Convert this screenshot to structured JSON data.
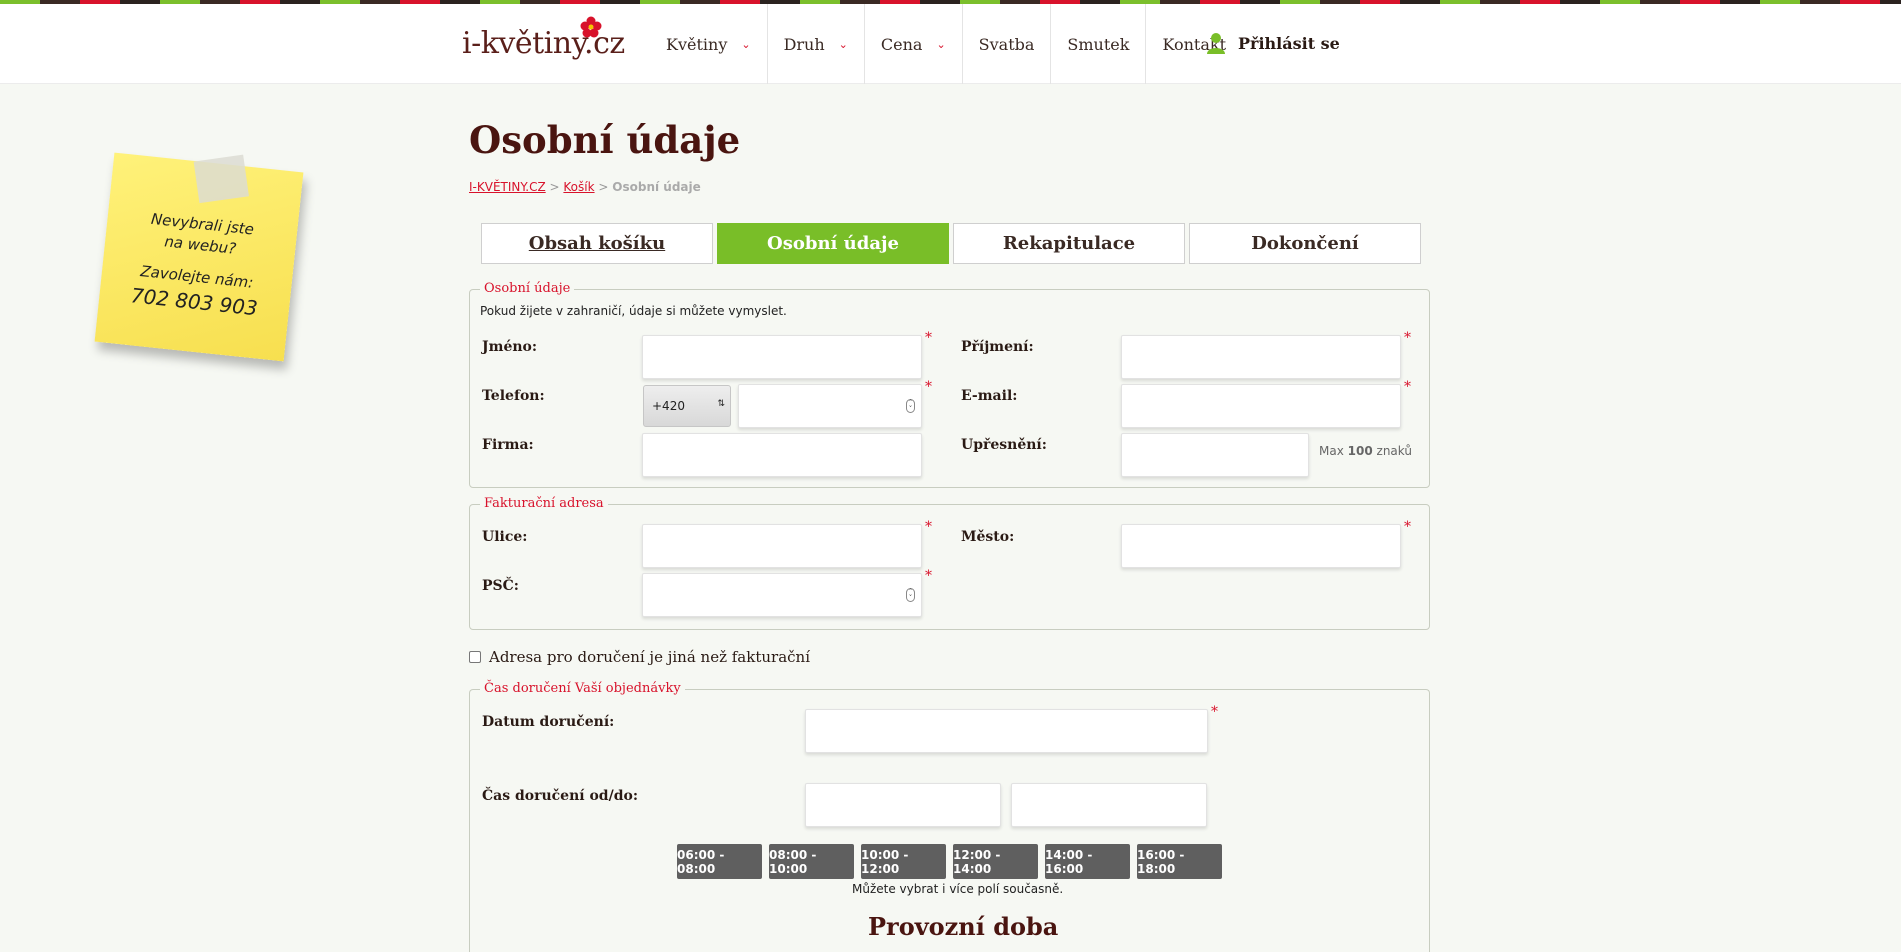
{
  "header": {
    "logo_text": "i-květiny.cz",
    "nav": [
      {
        "label": "Květiny",
        "dropdown": true
      },
      {
        "label": "Druh",
        "dropdown": true
      },
      {
        "label": "Cena",
        "dropdown": true
      },
      {
        "label": "Svatba",
        "dropdown": false
      },
      {
        "label": "Smutek",
        "dropdown": false
      },
      {
        "label": "Kontakt",
        "dropdown": false
      }
    ],
    "login_label": "Přihlásit se"
  },
  "sticky_note": {
    "line1": "Nevybrali jste",
    "line2": "na webu?",
    "line3": "Zavolejte nám:",
    "phone": "702 803 903"
  },
  "page_title": "Osobní údaje",
  "breadcrumb": {
    "home": "I-KVĚTINY.CZ",
    "cart": "Košík",
    "current": "Osobní údaje",
    "separator": ">"
  },
  "steps": [
    {
      "label": "Obsah košíku",
      "state": "done"
    },
    {
      "label": "Osobní údaje",
      "state": "active"
    },
    {
      "label": "Rekapitulace",
      "state": "todo"
    },
    {
      "label": "Dokončení",
      "state": "todo"
    }
  ],
  "personal": {
    "legend": "Osobní údaje",
    "hint": "Pokud žijete v zahraničí, údaje si můžete vymyslet.",
    "first_name_label": "Jméno:",
    "last_name_label": "Příjmení:",
    "phone_label": "Telefon:",
    "phone_prefix": "+420",
    "email_label": "E-mail:",
    "company_label": "Firma:",
    "detail_label": "Upřesnění:",
    "detail_note_pre": "Max",
    "detail_note_num": "100",
    "detail_note_post": "znaků",
    "required_mark": "*"
  },
  "billing": {
    "legend": "Fakturační adresa",
    "street_label": "Ulice:",
    "city_label": "Město:",
    "zip_label": "PSČ:"
  },
  "different_address_label": "Adresa pro doručení je jiná než fakturační",
  "delivery": {
    "legend": "Čas doručení Vaší objednávky",
    "date_label": "Datum doručení:",
    "time_label": "Čas doručení od/do:",
    "slots": [
      "06:00 - 08:00",
      "08:00 - 10:00",
      "10:00 - 12:00",
      "12:00 - 14:00",
      "14:00 - 16:00",
      "16:00 - 18:00"
    ],
    "slots_hint": "Můžete vybrat i více polí současně.",
    "opening_hours_title": "Provozní doba"
  },
  "colors": {
    "accent_green": "#79be28",
    "accent_red": "#d8122b",
    "title_brown": "#4a1510"
  }
}
